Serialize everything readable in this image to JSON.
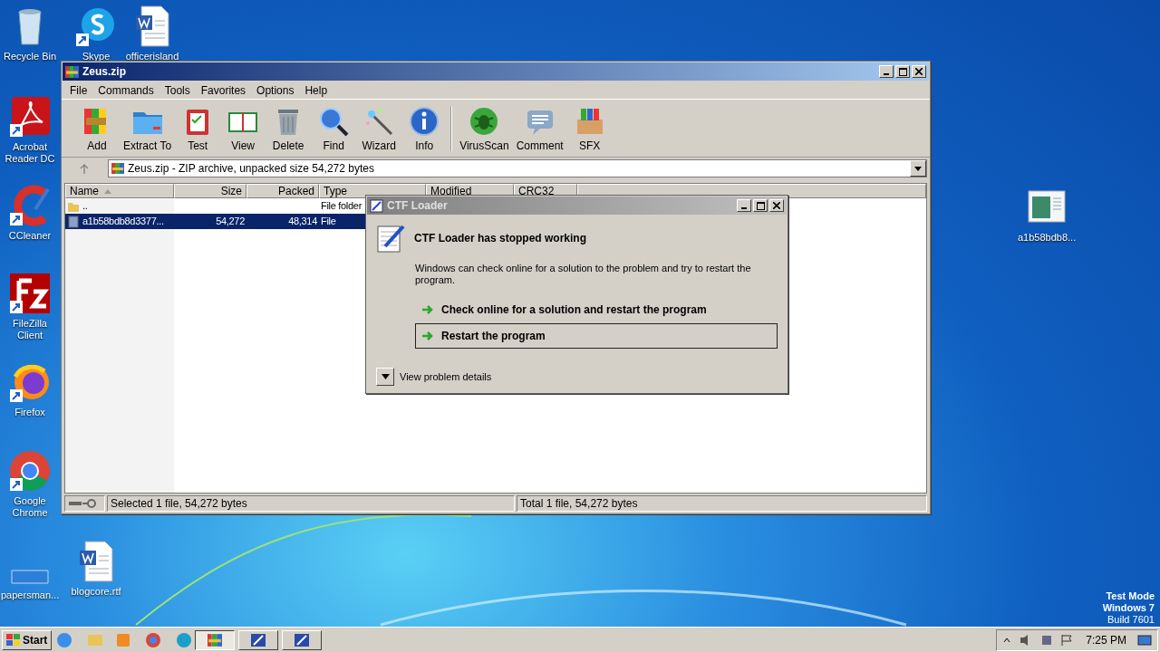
{
  "desktop_icons": [
    {
      "label": "Recycle Bin"
    },
    {
      "label": "Skype"
    },
    {
      "label": "officerisland"
    },
    {
      "label": "Acrobat Reader DC"
    },
    {
      "label": "CCleaner"
    },
    {
      "label": "FileZilla Client"
    },
    {
      "label": "Firefox"
    },
    {
      "label": "Google Chrome"
    },
    {
      "label": "papersman..."
    },
    {
      "label": "blogcore.rtf"
    },
    {
      "label": "a1b58bdb8..."
    }
  ],
  "window": {
    "title": "Zeus.zip",
    "menu": [
      "File",
      "Commands",
      "Tools",
      "Favorites",
      "Options",
      "Help"
    ],
    "toolbar": [
      {
        "label": "Add"
      },
      {
        "label": "Extract To"
      },
      {
        "label": "Test"
      },
      {
        "label": "View"
      },
      {
        "label": "Delete"
      },
      {
        "label": "Find"
      },
      {
        "label": "Wizard"
      },
      {
        "label": "Info"
      },
      {
        "label": "VirusScan"
      },
      {
        "label": "Comment"
      },
      {
        "label": "SFX"
      }
    ],
    "address": "Zeus.zip - ZIP archive, unpacked size 54,272 bytes",
    "table": {
      "columns": [
        "Name",
        "Size",
        "Packed",
        "Type",
        "Modified",
        "CRC32"
      ],
      "rows": [
        {
          "kind": "folder",
          "cells": [
            "..",
            "",
            "",
            "File folder"
          ],
          "selected": false
        },
        {
          "kind": "file",
          "cells": [
            "a1b58bdb8d3377...",
            "54,272",
            "48,314",
            "File"
          ],
          "selected": true
        }
      ]
    },
    "status_bar": [
      "Selected 1 file, 54,272 bytes",
      "Total 1 file, 54,272 bytes"
    ]
  },
  "dialog": {
    "title": "CTF Loader",
    "heading": "CTF Loader has stopped working",
    "message": "Windows can check online for a solution to the problem and try to restart the program.",
    "options": [
      {
        "label": "Check online for a solution and restart the program",
        "focused": false
      },
      {
        "label": "Restart the program",
        "focused": true
      }
    ],
    "details": "View problem details"
  },
  "watermark_text": [
    "Test Mode",
    "Windows 7",
    "Build 7601"
  ],
  "taskbar": {
    "start": "Start",
    "tasks": [
      {
        "selected": true
      },
      {
        "selected": false
      },
      {
        "selected": false
      }
    ],
    "clock": "7:25 PM"
  }
}
